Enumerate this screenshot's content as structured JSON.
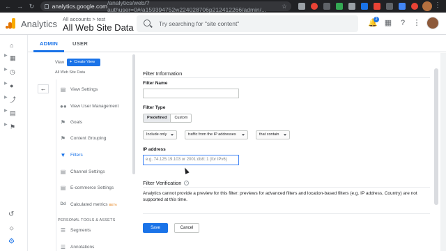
{
  "browser": {
    "url_host": "analytics.google.com",
    "url_path": "/analytics/web/?authuser=0#/a159394752w224028706p212412266/admin/..."
  },
  "header": {
    "app_name": "Analytics",
    "account_crumb": "All accounts > test",
    "view_name": "All Web Site Data",
    "search_placeholder": "Try searching for \"site content\"",
    "notification_count": "2"
  },
  "tabs": [
    {
      "label": "ADMIN"
    },
    {
      "label": "USER"
    }
  ],
  "view_column": {
    "view_label": "View",
    "create_view": "Create View",
    "current_view": "All Web Site Data",
    "items": [
      {
        "label": "View Settings",
        "icon": "document-icon"
      },
      {
        "label": "View User Management",
        "icon": "users-icon"
      },
      {
        "label": "Goals",
        "icon": "flag-icon"
      },
      {
        "label": "Content Grouping",
        "icon": "content-grouping-icon"
      },
      {
        "label": "Filters",
        "icon": "filter-icon"
      },
      {
        "label": "Channel Settings",
        "icon": "channel-icon"
      },
      {
        "label": "E-commerce Settings",
        "icon": "cart-icon"
      },
      {
        "label": "Calculated metrics",
        "icon": "dd-icon",
        "badge": "BETA"
      }
    ],
    "section_heading": "PERSONAL TOOLS & ASSETS",
    "section_items": [
      {
        "label": "Segments",
        "icon": "segments-icon"
      },
      {
        "label": "Annotations",
        "icon": "annotations-icon"
      }
    ]
  },
  "form": {
    "title": "Filter Information",
    "filter_name_label": "Filter Name",
    "filter_name_value": "",
    "filter_type_label": "Filter Type",
    "type_options": [
      "Predefined",
      "Custom"
    ],
    "type_selected": "Predefined",
    "include_select": "Include only",
    "source_select": "traffic from the IP addresses",
    "condition_select": "that contain",
    "ip_label": "IP address",
    "ip_placeholder": "e.g. 74.125.19.103 or 2001:db8::1 (for IPv6)",
    "verification_title": "Filter Verification",
    "verification_text": "Analytics cannot provide a preview for this filter: previews for advanced filters and location-based filters (e.g. IP address, Country) are not supported at this time.",
    "save_label": "Save",
    "cancel_label": "Cancel"
  },
  "colors": {
    "accent": "#1a73e8",
    "ga_orange": "#f9ab00"
  }
}
